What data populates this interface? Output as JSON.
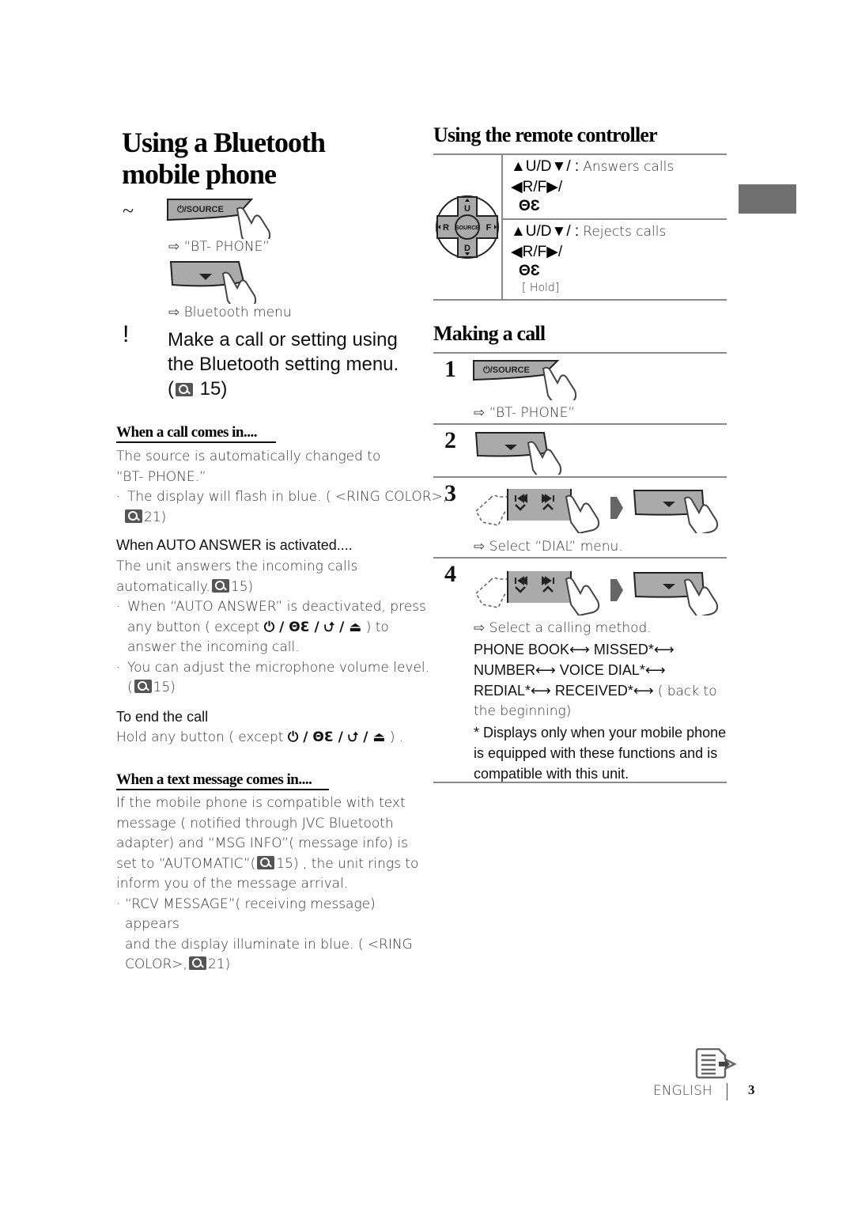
{
  "left": {
    "title_line1": "Using a Bluetooth",
    "title_line2": "mobile phone",
    "step_tilde": "~",
    "source_button_label": "⏻/SOURCE",
    "result_bt_phone": "“BT- PHONE”",
    "result_bt_menu": "Bluetooth menu",
    "step_excl": "!",
    "main_instruction_line1": "Make a call or setting using",
    "main_instruction_line2": "the Bluetooth setting menu.",
    "main_instruction_ref": "15)",
    "call_section": {
      "heading": "When a call comes in....",
      "para_line1": "The source is automatically changed to",
      "para_line2": "“BT- PHONE.”",
      "bullet1_line1": "The display will flash in blue. ( <RING COLOR>,",
      "bullet1_ref": "21)",
      "auto_heading": "When  AUTO ANSWER  is activated....",
      "auto_line1": "The unit answers the incoming calls",
      "auto_line2": "automatically.",
      "auto_ref": "15)",
      "bullet2_line1": "When “AUTO ANSWER” is deactivated, press",
      "bullet2_line2a": "any button ( except",
      "bullet2_line2b": ") to",
      "bullet2_line3": "answer the incoming call.",
      "bullet3_line1": "You can adjust the microphone volume level.",
      "bullet3_ref": "15)",
      "end_heading": "To end the call",
      "end_line_a": "Hold any button ( except",
      "end_line_b": ") .",
      "except_buttons": "⏻ / ΘƐ     / ⮍ / ⏏"
    },
    "text_section": {
      "heading": "When a text message comes in....",
      "line1": "If the mobile phone is compatible with text",
      "line2": "message ( notified through JVC Bluetooth",
      "line3": "adapter)  and “MSG INFO”( message info)  is",
      "line4a": "set to “AUTOMATIC”(",
      "line4b": "15) , the unit rings to",
      "line5": "inform you of the message arrival.",
      "bullet1_line1": "“RCV MESSAGE”( receiving message)  appears",
      "bullet1_line2": "and the display illuminate in blue. ( <RING",
      "bullet1_line3a": "COLOR>,",
      "bullet1_line3b": "21)"
    }
  },
  "right": {
    "remote_heading": "Using the remote controller",
    "remote_pad": {
      "up": "U",
      "down": "D",
      "left": "R",
      "right": "F",
      "center": "SOURCE"
    },
    "remote_rows": [
      {
        "keys1": "▲U/D▼/ :",
        "action": "Answers calls",
        "keys2": "◀R/F▶/",
        "keys3": "ΘƐ",
        "note": ""
      },
      {
        "keys1": "▲U/D▼/ :",
        "action": "Rejects calls",
        "keys2": "◀R/F▶/",
        "keys3": "ΘƐ",
        "note": "[ Hold]"
      }
    ],
    "making_heading": "Making a call",
    "steps": [
      {
        "num": "1",
        "button": "⏻/SOURCE",
        "result": "“BT- PHONE”"
      },
      {
        "num": "2",
        "result": ""
      },
      {
        "num": "3",
        "result": "Select “DIAL” menu."
      },
      {
        "num": "4",
        "result": "Select a calling method."
      }
    ],
    "methods_line1": "PHONE BOOK⟷ MISSED*⟷",
    "methods_line2": "NUMBER⟷ VOICE DIAL*⟷",
    "methods_line3a": "REDIAL*⟷ RECEIVED*⟷",
    "methods_line3b": "( back to",
    "methods_line4": "the beginning)",
    "footnote_line1": "* Displays only when your mobile phone",
    "footnote_line2": "is equipped with these functions and is",
    "footnote_line3": "compatible with this unit."
  },
  "footer": {
    "language": "ENGLISH",
    "page_number": "3",
    "tab_color": "#6f6f6f"
  }
}
